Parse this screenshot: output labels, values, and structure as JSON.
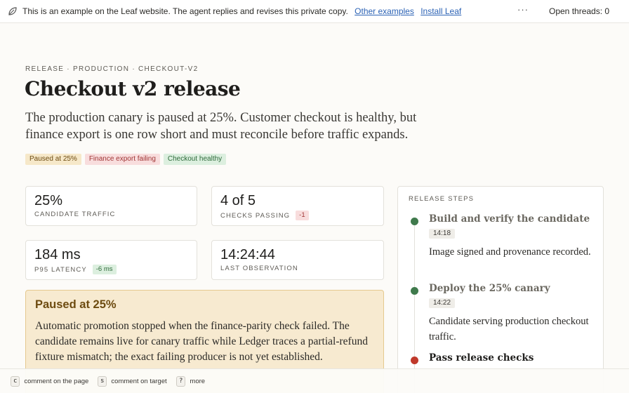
{
  "banner": {
    "icon": "leaf-icon",
    "message": "This is an example on the Leaf website. The agent replies and revises this private copy.",
    "link_examples": "Other examples",
    "link_install": "Install Leaf",
    "more": "···",
    "threads": "Open threads: 0"
  },
  "page": {
    "breadcrumb": "RELEASE · PRODUCTION · CHECKOUT-V2",
    "title": "Checkout v2 release",
    "lede": "The production canary is paused at 25%. Customer checkout is healthy, but finance export is one row short and must reconcile before traffic expands.",
    "badges": [
      {
        "label": "Paused at 25%",
        "tone": "amber"
      },
      {
        "label": "Finance export failing",
        "tone": "red"
      },
      {
        "label": "Checkout healthy",
        "tone": "green"
      }
    ]
  },
  "stats": [
    {
      "value": "25%",
      "label": "CANDIDATE TRAFFIC",
      "delta": ""
    },
    {
      "value": "4 of 5",
      "label": "CHECKS PASSING",
      "delta": "-1"
    },
    {
      "value": "184 ms",
      "label": "P95 LATENCY",
      "delta": "-6 ms"
    },
    {
      "value": "14:24:44",
      "label": "LAST OBSERVATION",
      "delta": ""
    }
  ],
  "pause_panel": {
    "title": "Paused at 25%",
    "body": "Automatic promotion stopped when the finance-parity check failed. The candidate remains live for canary traffic while Ledger traces a partial-refund fixture mismatch; the exact failing producer is not yet established."
  },
  "release_steps": {
    "heading": "RELEASE STEPS",
    "steps": [
      {
        "name": "Build and verify the candidate",
        "time": "14:18",
        "desc": "Image signed and provenance recorded.",
        "status": "done"
      },
      {
        "name": "Deploy the 25% canary",
        "time": "14:22",
        "desc": "Candidate serving production checkout traffic.",
        "status": "done"
      },
      {
        "name": "Pass release checks",
        "time": "",
        "desc": "",
        "status": "failed"
      }
    ]
  },
  "colors": {
    "done": "#3f7a4c",
    "failed": "#c0392b",
    "accent_link": "#2c63b5"
  },
  "footer": {
    "shortcuts": [
      {
        "key": "c",
        "label": "comment on the page"
      },
      {
        "key": "s",
        "label": "comment on target"
      },
      {
        "key": "?",
        "label": "more"
      }
    ]
  }
}
